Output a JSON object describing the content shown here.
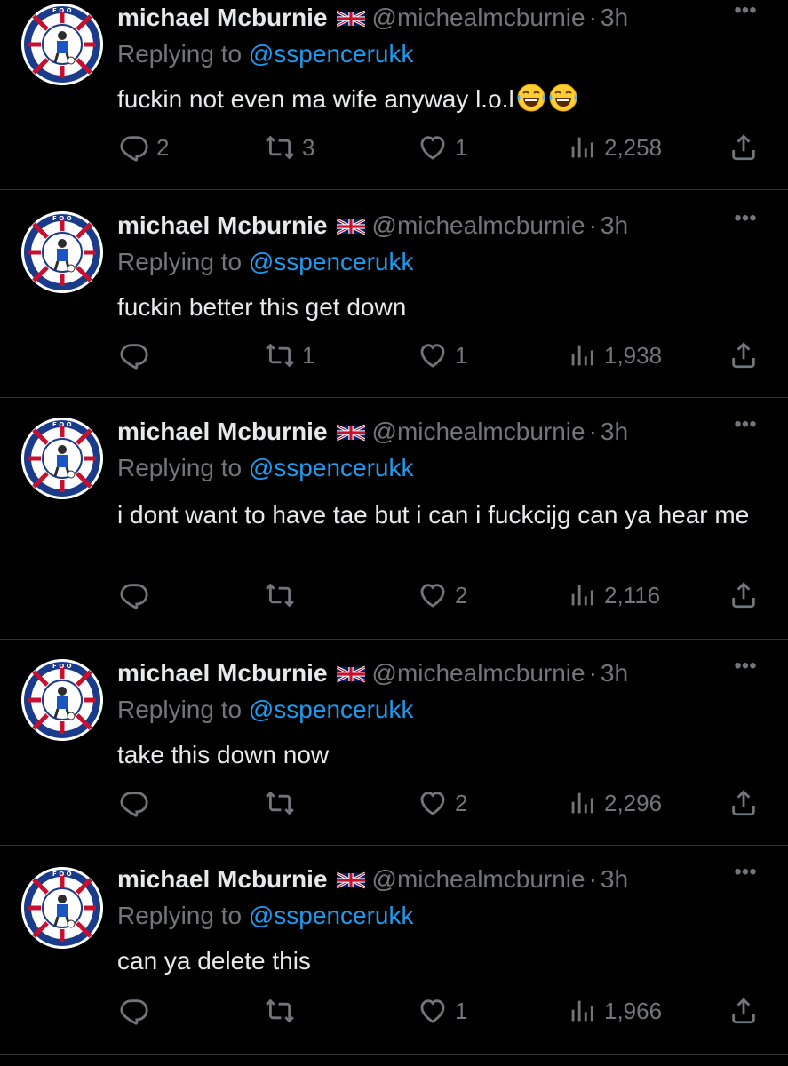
{
  "tweets": [
    {
      "name": "michael Mcburnie",
      "handle": "@michealmcburnie",
      "separator": "·",
      "time": "3h",
      "replying_prefix": "Replying to ",
      "replying_to": "@sspencerukk",
      "text": "fuckin not even ma wife anyway l.o.l",
      "emojis": [
        "face-with-tears-of-joy",
        "face-with-tears-of-joy"
      ],
      "replies": "2",
      "retweets": "3",
      "likes": "1",
      "views": "2,258"
    },
    {
      "name": "michael Mcburnie",
      "handle": "@michealmcburnie",
      "separator": "·",
      "time": "3h",
      "replying_prefix": "Replying to ",
      "replying_to": "@sspencerukk",
      "text": "fuckin better this get down",
      "replies": "",
      "retweets": "1",
      "likes": "1",
      "views": "1,938"
    },
    {
      "name": "michael Mcburnie",
      "handle": "@michealmcburnie",
      "separator": "·",
      "time": "3h",
      "replying_prefix": "Replying to ",
      "replying_to": "@sspencerukk",
      "text": "i dont want to have tae but i can i fuckcijg can ya hear me",
      "replies": "",
      "retweets": "",
      "likes": "2",
      "views": "2,116"
    },
    {
      "name": "michael Mcburnie",
      "handle": "@michealmcburnie",
      "separator": "·",
      "time": "3h",
      "replying_prefix": "Replying to ",
      "replying_to": "@sspencerukk",
      "text": "take this down now",
      "replies": "",
      "retweets": "",
      "likes": "2",
      "views": "2,296"
    },
    {
      "name": "michael Mcburnie",
      "handle": "@michealmcburnie",
      "separator": "·",
      "time": "3h",
      "replying_prefix": "Replying to ",
      "replying_to": "@sspencerukk",
      "text": "can ya delete this",
      "replies": "",
      "retweets": "",
      "likes": "1",
      "views": "1,966"
    }
  ],
  "icons": {
    "more": "more-horizontal-icon",
    "reply": "reply-icon",
    "retweet": "retweet-icon",
    "like": "heart-icon",
    "views": "views-chart-icon",
    "share": "share-icon",
    "flag": "uk-flag-icon"
  },
  "colors": {
    "background": "#000000",
    "text": "#e7e9ea",
    "muted": "#71767b",
    "link": "#1d9bf0",
    "divider": "#2f3336"
  }
}
